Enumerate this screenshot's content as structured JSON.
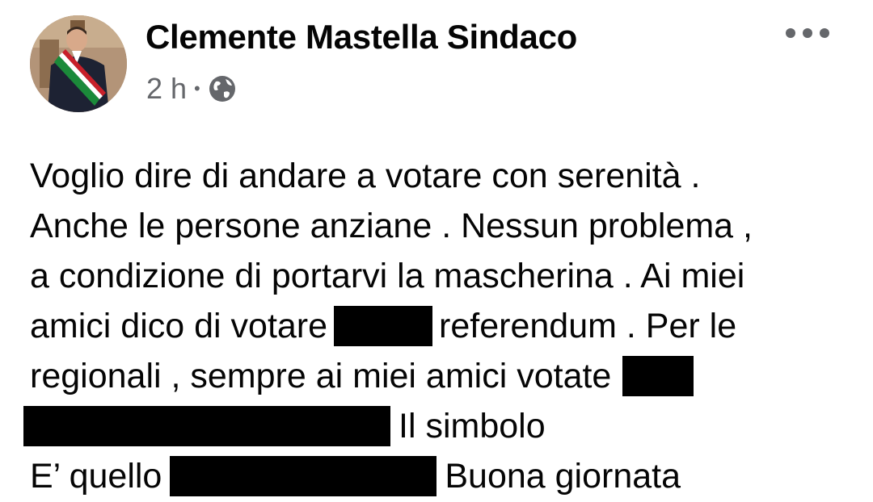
{
  "post": {
    "author_name": "Clemente Mastella Sindaco",
    "timestamp": "2 h",
    "separator": "•",
    "privacy_icon": "globe-icon",
    "more_icon": "more-horizontal-icon",
    "avatar_icon": "profile-photo-avatar",
    "lines": [
      {
        "text": "Voglio dire di andare a votare con serenità ."
      },
      {
        "text": "Anche le persone anziane . Nessun problema ,"
      },
      {
        "text": "a condizione di portarvi la mascherina . Ai miei"
      },
      {
        "before": "amici dico di votare",
        "after": "referendum . Per le"
      },
      {
        "before": "regionali , sempre ai miei amici votate"
      },
      {
        "after": "Il simbolo"
      },
      {
        "before": "E’ quello",
        "after": "Buona giornata"
      }
    ]
  },
  "colors": {
    "text_primary": "#050505",
    "text_secondary": "#65676b",
    "redaction": "#000000",
    "background": "#ffffff"
  }
}
